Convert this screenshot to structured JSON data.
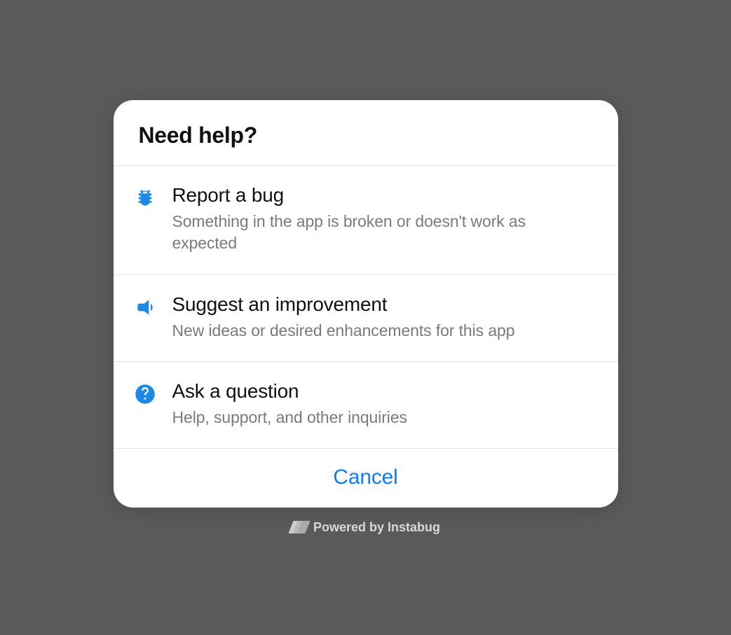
{
  "modal": {
    "title": "Need help?",
    "options": [
      {
        "title": "Report a bug",
        "description": "Something in the app is broken or doesn't work as expected"
      },
      {
        "title": "Suggest an improvement",
        "description": "New ideas or desired enhancements for this app"
      },
      {
        "title": "Ask a question",
        "description": "Help, support, and other inquiries"
      }
    ],
    "cancel": "Cancel"
  },
  "footer": {
    "text": "Powered by Instabug"
  },
  "colors": {
    "accent": "#0a7aff",
    "iconBlue": "#1e88e5"
  }
}
